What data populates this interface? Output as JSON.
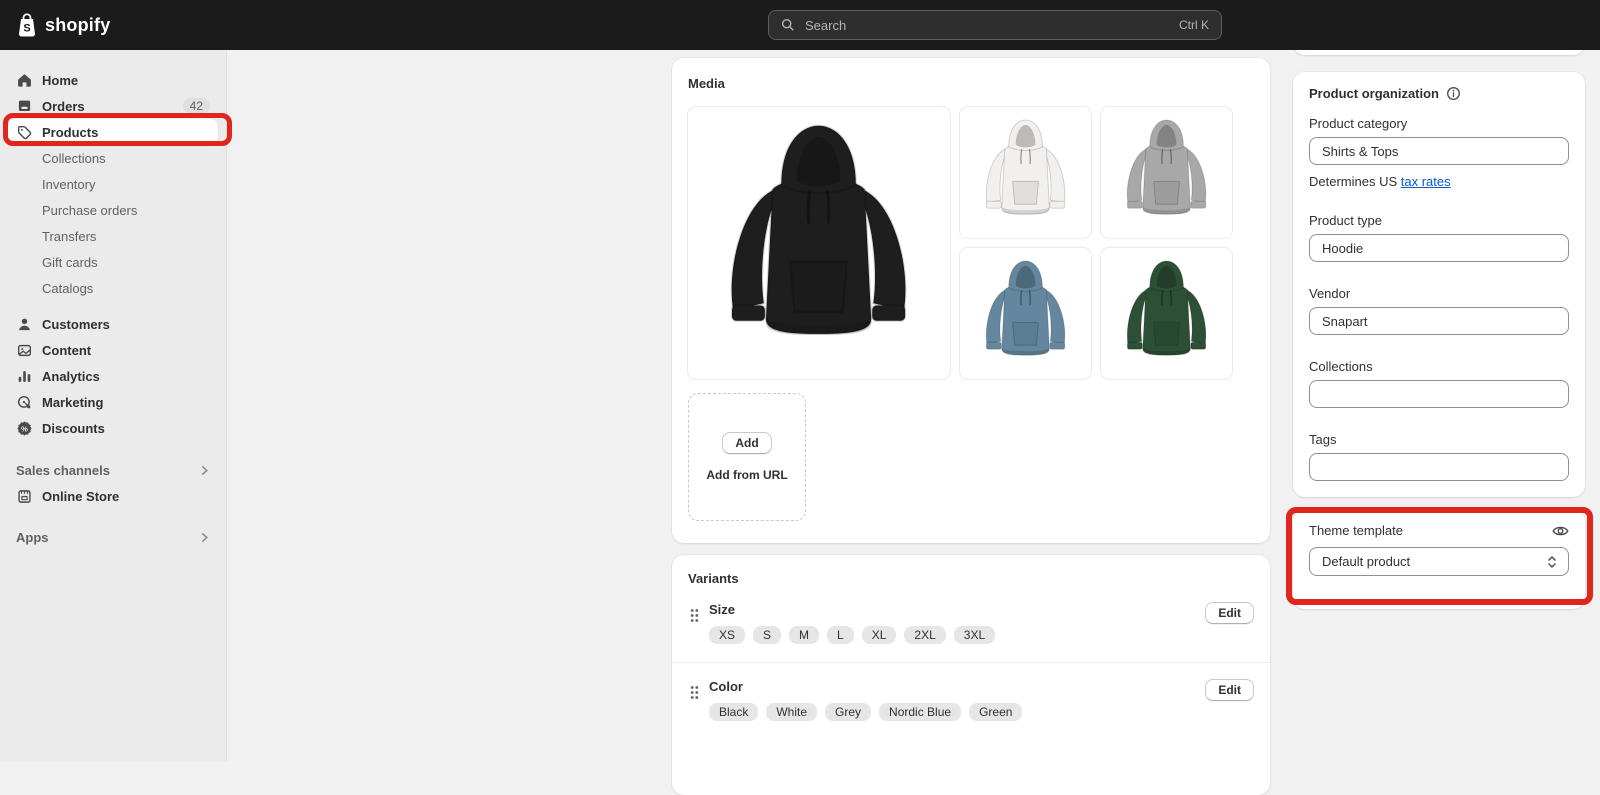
{
  "topbar": {
    "brand": "shopify",
    "search": {
      "placeholder": "Search",
      "shortcut": "Ctrl K"
    }
  },
  "sidebar": {
    "items": [
      {
        "label": "Home",
        "icon": "home-icon"
      },
      {
        "label": "Orders",
        "icon": "orders-icon",
        "badge": "42"
      },
      {
        "label": "Products",
        "icon": "products-icon",
        "selected": true,
        "annotated": true
      },
      {
        "label": "Collections",
        "sub": true
      },
      {
        "label": "Inventory",
        "sub": true
      },
      {
        "label": "Purchase orders",
        "sub": true
      },
      {
        "label": "Transfers",
        "sub": true
      },
      {
        "label": "Gift cards",
        "sub": true
      },
      {
        "label": "Catalogs",
        "sub": true
      },
      {
        "label": "Customers",
        "icon": "customers-icon"
      },
      {
        "label": "Content",
        "icon": "content-icon"
      },
      {
        "label": "Analytics",
        "icon": "analytics-icon"
      },
      {
        "label": "Marketing",
        "icon": "marketing-icon"
      },
      {
        "label": "Discounts",
        "icon": "discounts-icon"
      }
    ],
    "sales_channels": {
      "label": "Sales channels",
      "items": [
        {
          "label": "Online Store",
          "icon": "store-icon"
        }
      ]
    },
    "apps": {
      "label": "Apps"
    }
  },
  "media": {
    "title": "Media",
    "add_button": "Add",
    "add_from_url": "Add from URL",
    "images": [
      {
        "name": "black-hoodie",
        "color": "#1e1e1e"
      },
      {
        "name": "white-hoodie",
        "color": "#f1f0ee"
      },
      {
        "name": "grey-hoodie",
        "color": "#a8a8a8"
      },
      {
        "name": "nordic-blue-hoodie",
        "color": "#64869e"
      },
      {
        "name": "green-hoodie",
        "color": "#2c4f35"
      }
    ]
  },
  "variants": {
    "title": "Variants",
    "rows": [
      {
        "name": "Size",
        "values": [
          "XS",
          "S",
          "M",
          "L",
          "XL",
          "2XL",
          "3XL"
        ],
        "edit": "Edit"
      },
      {
        "name": "Color",
        "values": [
          "Black",
          "White",
          "Grey",
          "Nordic Blue",
          "Green"
        ],
        "edit": "Edit"
      }
    ]
  },
  "organization": {
    "title": "Product organization",
    "category": {
      "label": "Product category",
      "value": "Shirts & Tops"
    },
    "tax_note": {
      "text": "Determines US ",
      "link": "tax rates"
    },
    "type": {
      "label": "Product type",
      "value": "Hoodie"
    },
    "vendor": {
      "label": "Vendor",
      "value": "Snapart"
    },
    "collections": {
      "label": "Collections",
      "value": ""
    },
    "tags": {
      "label": "Tags",
      "value": ""
    }
  },
  "theme": {
    "label": "Theme template",
    "value": "Default product"
  },
  "annotation_color": "#e0251c"
}
